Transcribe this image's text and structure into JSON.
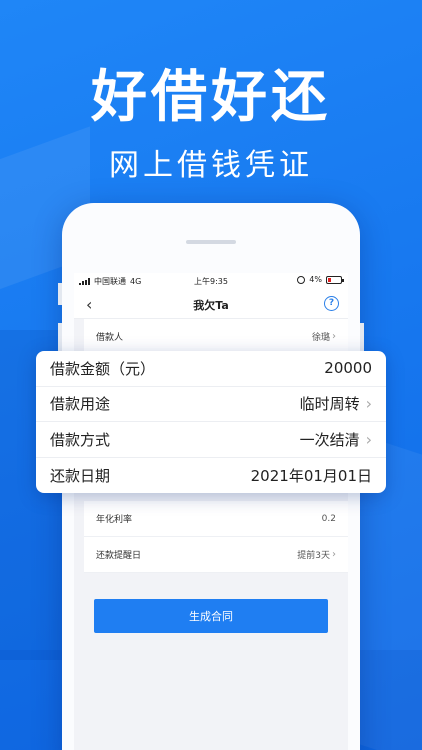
{
  "hero": {
    "title": "好借好还",
    "subtitle": "网上借钱凭证"
  },
  "status_bar": {
    "carrier": "中国联通",
    "network": "4G",
    "time": "上午9:35",
    "battery": "4%"
  },
  "nav": {
    "title": "我欠Ta"
  },
  "list": {
    "borrower_label": "借款人",
    "borrower_value": "徐璐",
    "rate_label": "年化利率",
    "rate_value": "0.2",
    "reminder_label": "还款提醒日",
    "reminder_value": "提前3天"
  },
  "card": {
    "amount_label": "借款金额（元）",
    "amount_value": "20000",
    "purpose_label": "借款用途",
    "purpose_value": "临时周转",
    "method_label": "借款方式",
    "method_value": "一次结清",
    "due_label": "还款日期",
    "due_value": "2021年01月01日"
  },
  "action": {
    "generate_label": "生成合同"
  },
  "colors": {
    "primary": "#1f7ef2",
    "background": "#1676ee"
  }
}
